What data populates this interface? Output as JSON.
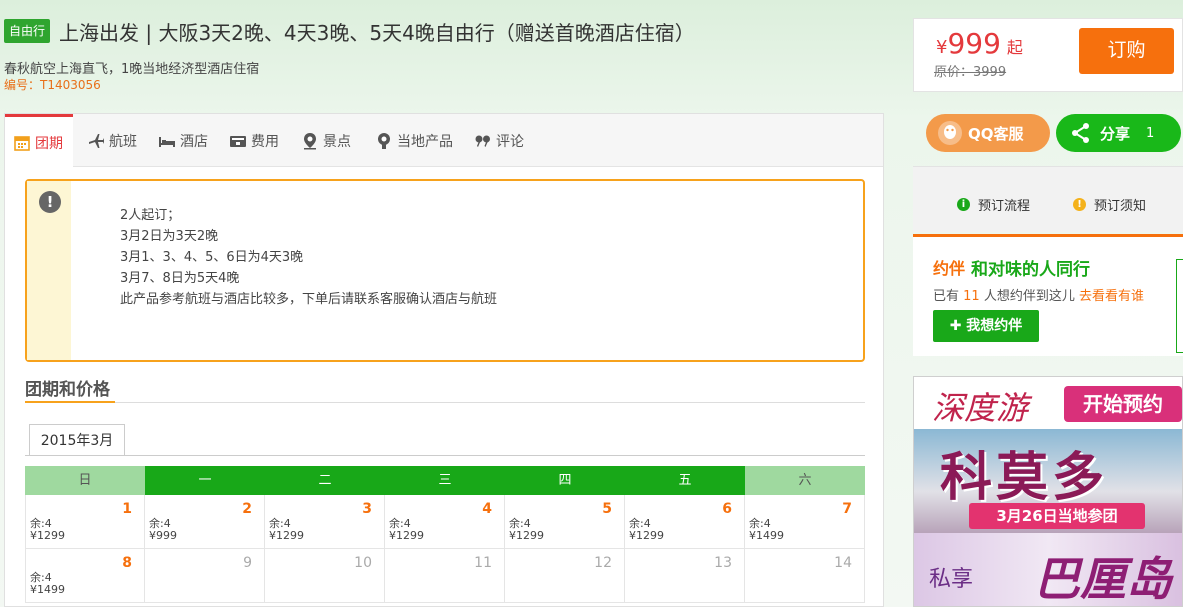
{
  "header": {
    "tag": "自由行",
    "title": "上海出发 | 大阪3天2晚、4天3晚、5天4晚自由行（赠送首晚酒店住宿）",
    "subtitle": "春秋航空上海直飞，1晚当地经济型酒店住宿",
    "code": "编号：T1403056"
  },
  "price": {
    "currency": "¥",
    "value": "999",
    "suffix": "起",
    "original": "原价：3999",
    "order_label": "订购"
  },
  "tabs": [
    {
      "label": "团期",
      "icon": "calendar-icon"
    },
    {
      "label": "航班",
      "icon": "airplane-icon"
    },
    {
      "label": "酒店",
      "icon": "bed-icon"
    },
    {
      "label": "费用",
      "icon": "wallet-icon"
    },
    {
      "label": "景点",
      "icon": "location-pin-icon"
    },
    {
      "label": "当地产品",
      "icon": "local-product-icon"
    },
    {
      "label": "评论",
      "icon": "quote-icon"
    }
  ],
  "notice": {
    "lines": [
      "2人起订；",
      "3月2日为3天2晚",
      "3月1、3、4、5、6日为4天3晚",
      "3月7、8日为5天4晚",
      "此产品参考航班与酒店比较多，下单后请联系客服确认酒店与航班"
    ]
  },
  "section": {
    "title": "团期和价格",
    "month_tab": "2015年3月"
  },
  "calendar": {
    "weekdays": [
      "日",
      "一",
      "二",
      "三",
      "四",
      "五",
      "六"
    ],
    "rows": [
      [
        {
          "day": "1",
          "stock": "余:4",
          "price": "¥1299"
        },
        {
          "day": "2",
          "stock": "余:4",
          "price": "¥999"
        },
        {
          "day": "3",
          "stock": "余:4",
          "price": "¥1299"
        },
        {
          "day": "4",
          "stock": "余:4",
          "price": "¥1299"
        },
        {
          "day": "5",
          "stock": "余:4",
          "price": "¥1299"
        },
        {
          "day": "6",
          "stock": "余:4",
          "price": "¥1299"
        },
        {
          "day": "7",
          "stock": "余:4",
          "price": "¥1499"
        }
      ],
      [
        {
          "day": "8",
          "stock": "余:4",
          "price": "¥1499"
        },
        {
          "day": "9",
          "stock": "",
          "price": ""
        },
        {
          "day": "10",
          "stock": "",
          "price": ""
        },
        {
          "day": "11",
          "stock": "",
          "price": ""
        },
        {
          "day": "12",
          "stock": "",
          "price": ""
        },
        {
          "day": "13",
          "stock": "",
          "price": ""
        },
        {
          "day": "14",
          "stock": "",
          "price": ""
        }
      ]
    ]
  },
  "sidebar": {
    "qq_label": "QQ客服",
    "share_label": "分享",
    "share_count": "1",
    "steps": [
      "预订流程",
      "预订须知"
    ],
    "yueban": {
      "logo": "约伴",
      "slogan": "和对味的人同行",
      "line_prefix": "已有",
      "count": "11",
      "line_mid": "人想约伴到这儿",
      "link": "去看看有谁",
      "button": "我想约伴"
    },
    "ads": {
      "ad1_text": "深度游",
      "ad1_button": "开始预约",
      "ad2_text": "科莫多",
      "ad2_sub": "3月26日当地参团",
      "ad3_left": "私享",
      "ad3_right": "巴厘岛"
    }
  },
  "colors": {
    "accent": "#f6700d",
    "green": "#18a818",
    "price_red": "#e4393c"
  }
}
